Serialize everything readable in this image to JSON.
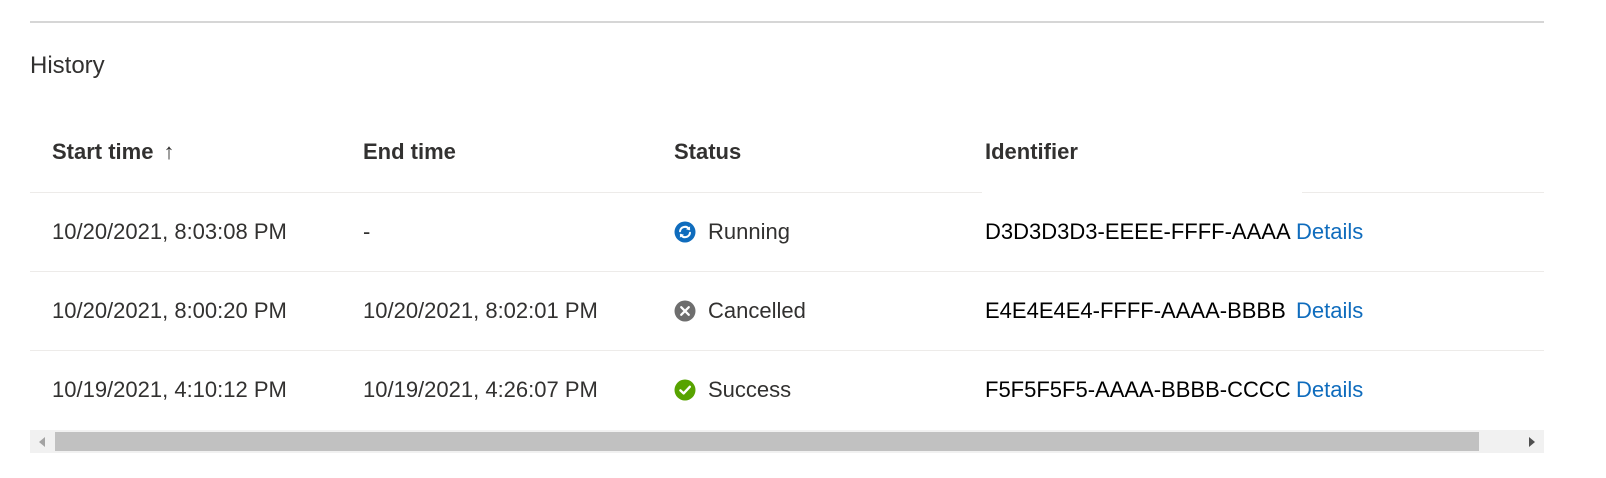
{
  "section": {
    "title": "History"
  },
  "table": {
    "columns": {
      "start_time": "Start time",
      "end_time": "End time",
      "status": "Status",
      "identifier": "Identifier"
    },
    "sort_indicator": "↑",
    "rows": [
      {
        "start": "10/20/2021, 8:03:08 PM",
        "end": "-",
        "status": "Running",
        "identifier": "D3D3D3D3-EEEE-FFFF-AAAA",
        "details": "Details"
      },
      {
        "start": "10/20/2021, 8:00:20 PM",
        "end": "10/20/2021, 8:02:01 PM",
        "status": "Cancelled",
        "identifier": "E4E4E4E4-FFFF-AAAA-BBBB",
        "details": "Details"
      },
      {
        "start": "10/19/2021, 4:10:12 PM",
        "end": "10/19/2021, 4:26:07 PM",
        "status": "Success",
        "identifier": "F5F5F5F5-AAAA-BBBB-CCCC",
        "details": "Details"
      }
    ]
  },
  "icons": {
    "running": "sync-icon",
    "cancelled": "cancelled-icon",
    "success": "checkmark-icon",
    "sort": "arrow-up-icon"
  },
  "colors": {
    "running": "#0f6cbd",
    "cancelled": "#6e6e6e",
    "success": "#57a300",
    "link": "#0f6cbd"
  }
}
